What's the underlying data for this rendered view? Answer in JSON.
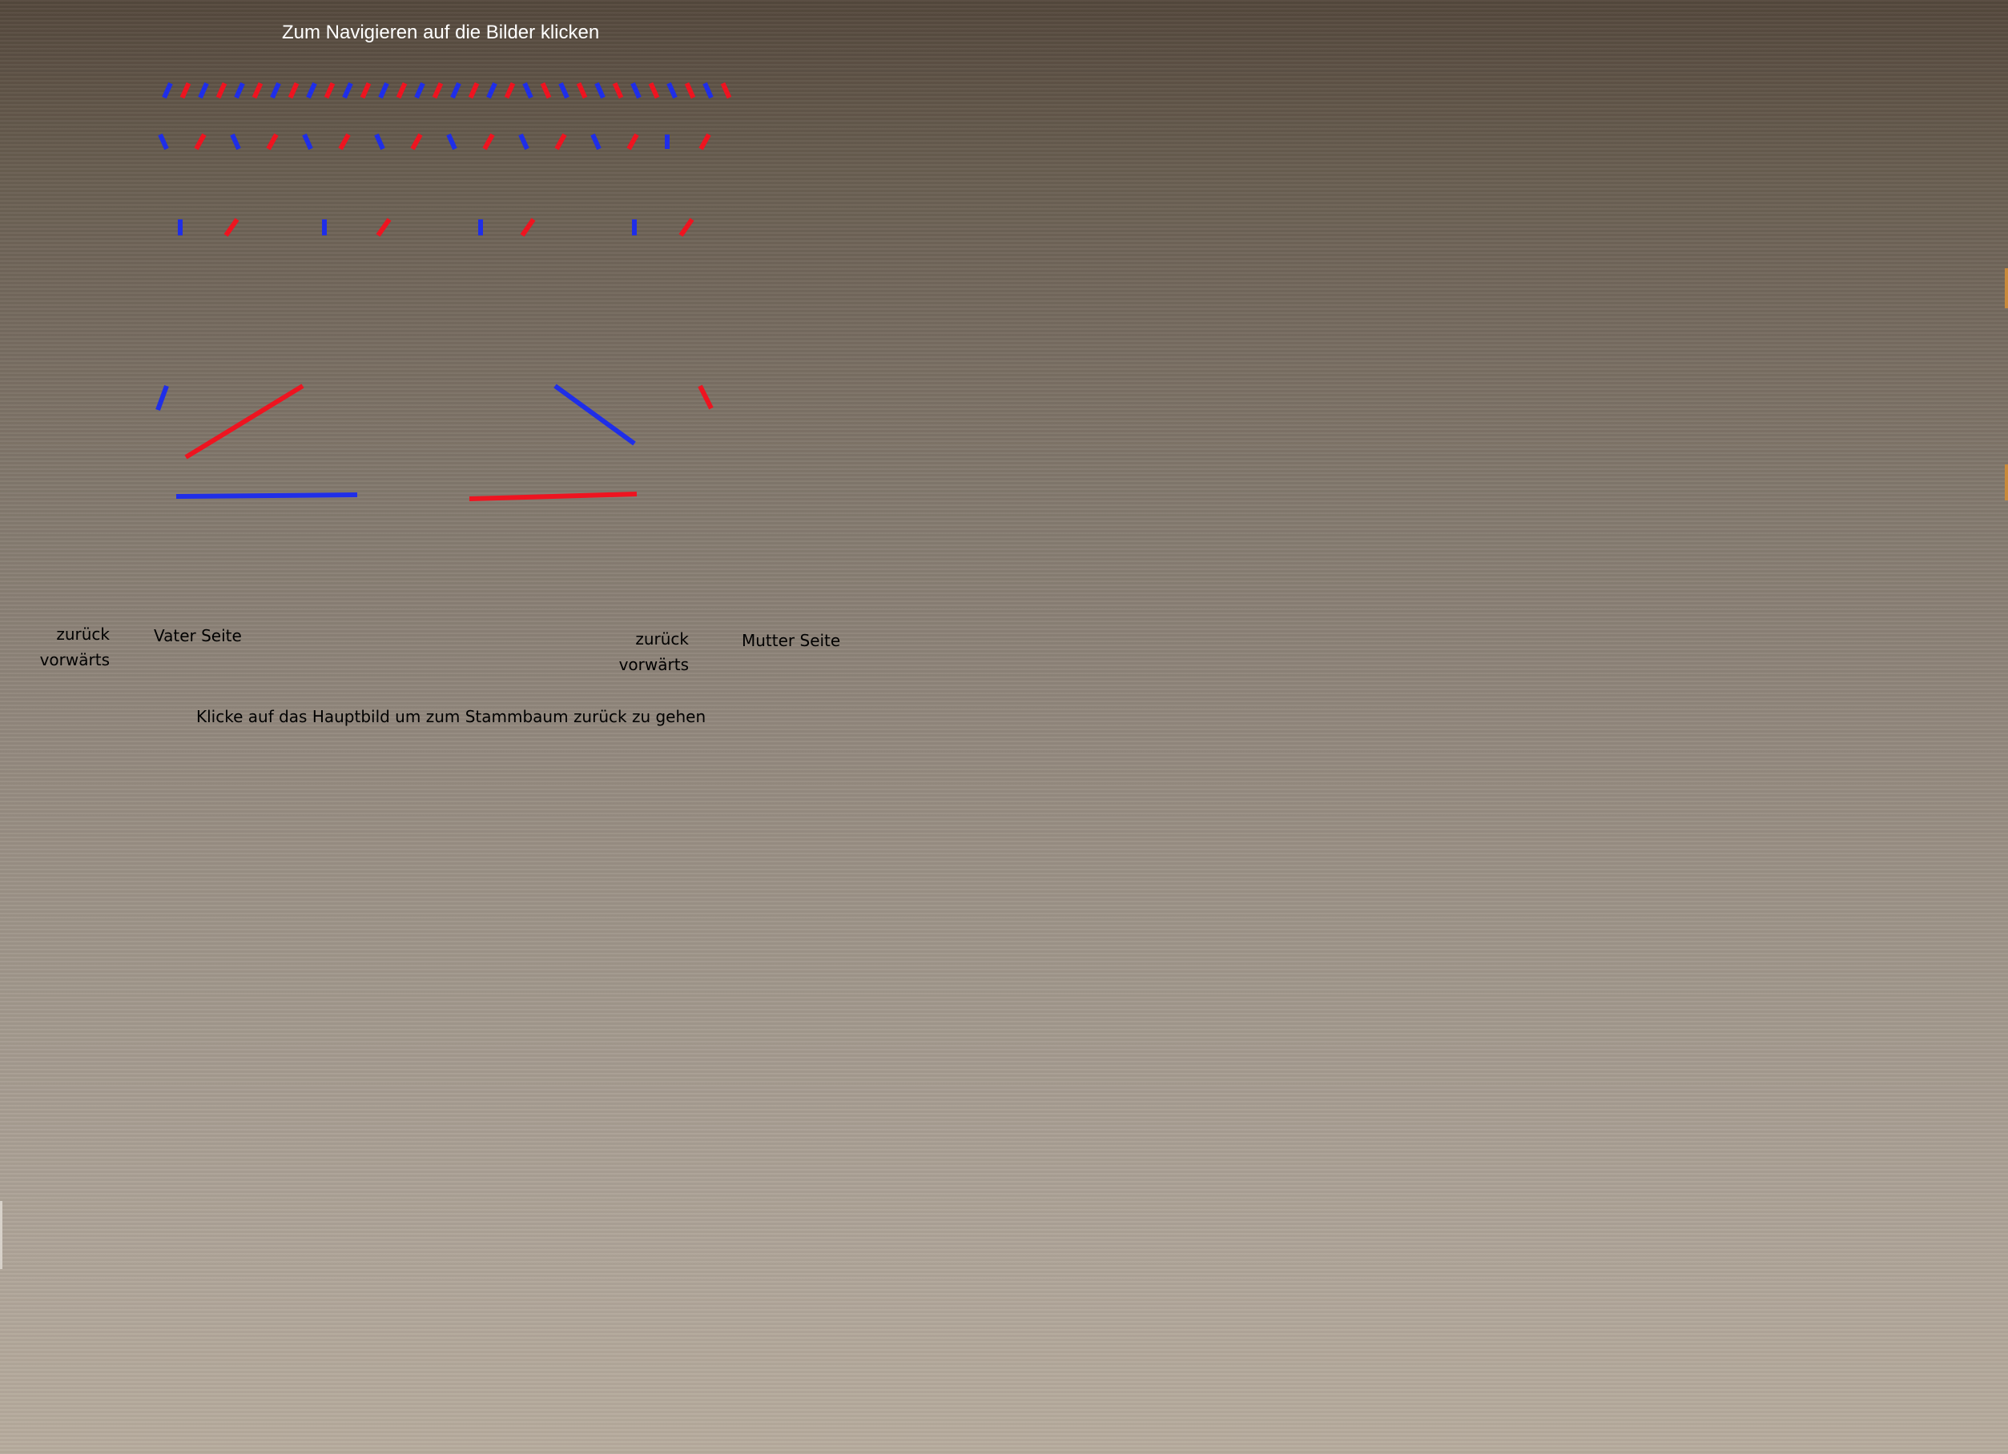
{
  "header": {
    "instruction": "Zum Navigieren auf die Bilder klicken"
  },
  "colors": {
    "father_line": "#1f2ee8",
    "mother_line": "#ee1420",
    "text_light": "#ffffff",
    "text_dark": "#000000"
  },
  "father_side": {
    "back_label": "zurück",
    "forward_label": "vorwärts",
    "side_label": "Vater Seite"
  },
  "mother_side": {
    "back_label": "zurück",
    "forward_label": "vorwärts",
    "side_label": "Mutter Seite"
  },
  "footer": {
    "note": "Klicke auf das Hauptbild um zum Stammbaum zurück zu gehen"
  }
}
